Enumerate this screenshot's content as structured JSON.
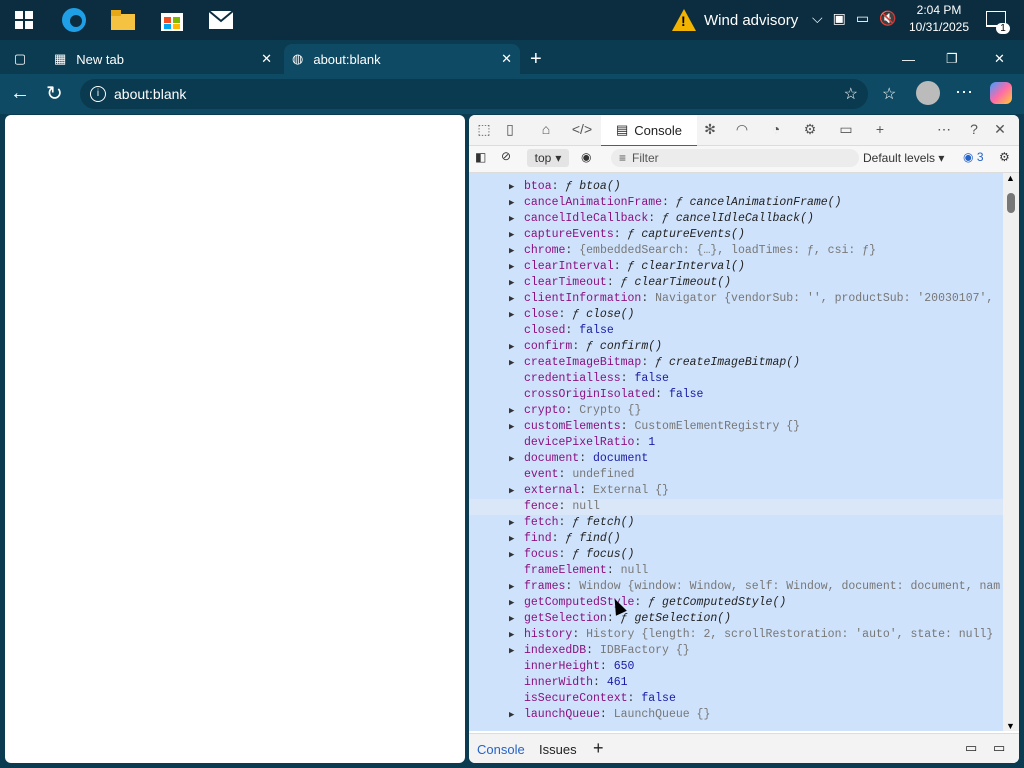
{
  "taskbar": {
    "weather_text": "Wind advisory",
    "time": "2:04 PM",
    "date": "10/31/2025",
    "notification_count": "1"
  },
  "browser": {
    "tabs": [
      {
        "label": "New tab"
      },
      {
        "label": "about:blank"
      }
    ],
    "address": "about:blank"
  },
  "devtools": {
    "console_tab": "Console",
    "context": "top",
    "filter_placeholder": "Filter",
    "levels": "Default levels",
    "issues_count": "3",
    "drawer": {
      "console": "Console",
      "issues": "Issues"
    },
    "lines": [
      {
        "expand": true,
        "key": "btoa",
        "sep": ": ",
        "value": "ƒ btoa()",
        "style": "fn"
      },
      {
        "expand": true,
        "key": "cancelAnimationFrame",
        "sep": ": ",
        "value": "ƒ cancelAnimationFrame()",
        "style": "fn"
      },
      {
        "expand": true,
        "key": "cancelIdleCallback",
        "sep": ": ",
        "value": "ƒ cancelIdleCallback()",
        "style": "fn"
      },
      {
        "expand": true,
        "key": "captureEvents",
        "sep": ": ",
        "value": "ƒ captureEvents()",
        "style": "fn"
      },
      {
        "expand": true,
        "key": "chrome",
        "sep": ": ",
        "value": "{embeddedSearch: {…}, loadTimes: ƒ, csi: ƒ}",
        "style": "gray"
      },
      {
        "expand": true,
        "key": "clearInterval",
        "sep": ": ",
        "value": "ƒ clearInterval()",
        "style": "fn"
      },
      {
        "expand": true,
        "key": "clearTimeout",
        "sep": ": ",
        "value": "ƒ clearTimeout()",
        "style": "fn"
      },
      {
        "expand": true,
        "key": "clientInformation",
        "sep": ": ",
        "value": "Navigator {vendorSub: '', productSub: '20030107',",
        "style": "gray"
      },
      {
        "expand": true,
        "key": "close",
        "sep": ": ",
        "value": "ƒ close()",
        "style": "fn"
      },
      {
        "expand": false,
        "key": "closed",
        "sep": ": ",
        "value": "false",
        "style": "val"
      },
      {
        "expand": true,
        "key": "confirm",
        "sep": ": ",
        "value": "ƒ confirm()",
        "style": "fn"
      },
      {
        "expand": true,
        "key": "createImageBitmap",
        "sep": ": ",
        "value": "ƒ createImageBitmap()",
        "style": "fn"
      },
      {
        "expand": false,
        "key": "credentialless",
        "sep": ": ",
        "value": "false",
        "style": "val"
      },
      {
        "expand": false,
        "key": "crossOriginIsolated",
        "sep": ": ",
        "value": "false",
        "style": "val"
      },
      {
        "expand": true,
        "key": "crypto",
        "sep": ": ",
        "value": "Crypto {}",
        "style": "gray"
      },
      {
        "expand": true,
        "key": "customElements",
        "sep": ": ",
        "value": "CustomElementRegistry {}",
        "style": "gray"
      },
      {
        "expand": false,
        "key": "devicePixelRatio",
        "sep": ": ",
        "value": "1",
        "style": "val"
      },
      {
        "expand": true,
        "key": "document",
        "sep": ": ",
        "value": "document",
        "style": "val"
      },
      {
        "expand": false,
        "key": "event",
        "sep": ": ",
        "value": "undefined",
        "style": "gray"
      },
      {
        "expand": true,
        "key": "external",
        "sep": ": ",
        "value": "External {}",
        "style": "gray"
      },
      {
        "expand": false,
        "key": "fence",
        "sep": ": ",
        "value": "null",
        "style": "gray",
        "hl": true
      },
      {
        "expand": true,
        "key": "fetch",
        "sep": ": ",
        "value": "ƒ fetch()",
        "style": "fn"
      },
      {
        "expand": true,
        "key": "find",
        "sep": ": ",
        "value": "ƒ find()",
        "style": "fn"
      },
      {
        "expand": true,
        "key": "focus",
        "sep": ": ",
        "value": "ƒ focus()",
        "style": "fn"
      },
      {
        "expand": false,
        "key": "frameElement",
        "sep": ": ",
        "value": "null",
        "style": "gray"
      },
      {
        "expand": true,
        "key": "frames",
        "sep": ": ",
        "value": "Window {window: Window, self: Window, document: document, nam",
        "style": "gray"
      },
      {
        "expand": true,
        "key": "getComputedStyle",
        "sep": ": ",
        "value": "ƒ getComputedStyle()",
        "style": "fn"
      },
      {
        "expand": true,
        "key": "getSelection",
        "sep": ": ",
        "value": "ƒ getSelection()",
        "style": "fn"
      },
      {
        "expand": true,
        "key": "history",
        "sep": ": ",
        "value": "History {length: 2, scrollRestoration: 'auto', state: null}",
        "style": "gray"
      },
      {
        "expand": true,
        "key": "indexedDB",
        "sep": ": ",
        "value": "IDBFactory {}",
        "style": "gray"
      },
      {
        "expand": false,
        "key": "innerHeight",
        "sep": ": ",
        "value": "650",
        "style": "val"
      },
      {
        "expand": false,
        "key": "innerWidth",
        "sep": ": ",
        "value": "461",
        "style": "val"
      },
      {
        "expand": false,
        "key": "isSecureContext",
        "sep": ": ",
        "value": "false",
        "style": "val"
      },
      {
        "expand": true,
        "key": "launchQueue",
        "sep": ": ",
        "value": "LaunchQueue {}",
        "style": "gray"
      }
    ]
  }
}
